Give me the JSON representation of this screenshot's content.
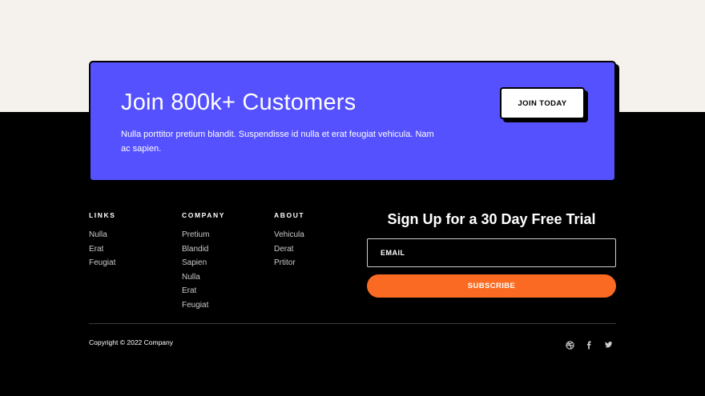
{
  "cta": {
    "title": "Join 800k+ Customers",
    "text": "Nulla porttitor pretium blandit. Suspendisse id nulla et erat feugiat vehicula. Nam ac sapien.",
    "button_label": "JOIN TODAY",
    "background_color": "#5551ff"
  },
  "footer": {
    "columns": [
      {
        "heading": "LINKS",
        "items": [
          "Nulla",
          "Erat",
          "Feugiat"
        ]
      },
      {
        "heading": "COMPANY",
        "items": [
          "Pretium",
          "Blandid",
          "Sapien",
          "Nulla",
          "Erat",
          "Feugiat"
        ]
      },
      {
        "heading": "ABOUT",
        "items": [
          "Vehicula",
          "Derat",
          "Prtitor"
        ]
      }
    ],
    "signup": {
      "title": "Sign Up for a 30 Day Free Trial",
      "email_placeholder": "EMAIL",
      "subscribe_label": "SUBSCRIBE",
      "accent_color": "#fb6a22"
    },
    "copyright": "Copyright © 2022 Company",
    "social_icons": [
      "dribbble-icon",
      "facebook-icon",
      "twitter-icon"
    ]
  }
}
